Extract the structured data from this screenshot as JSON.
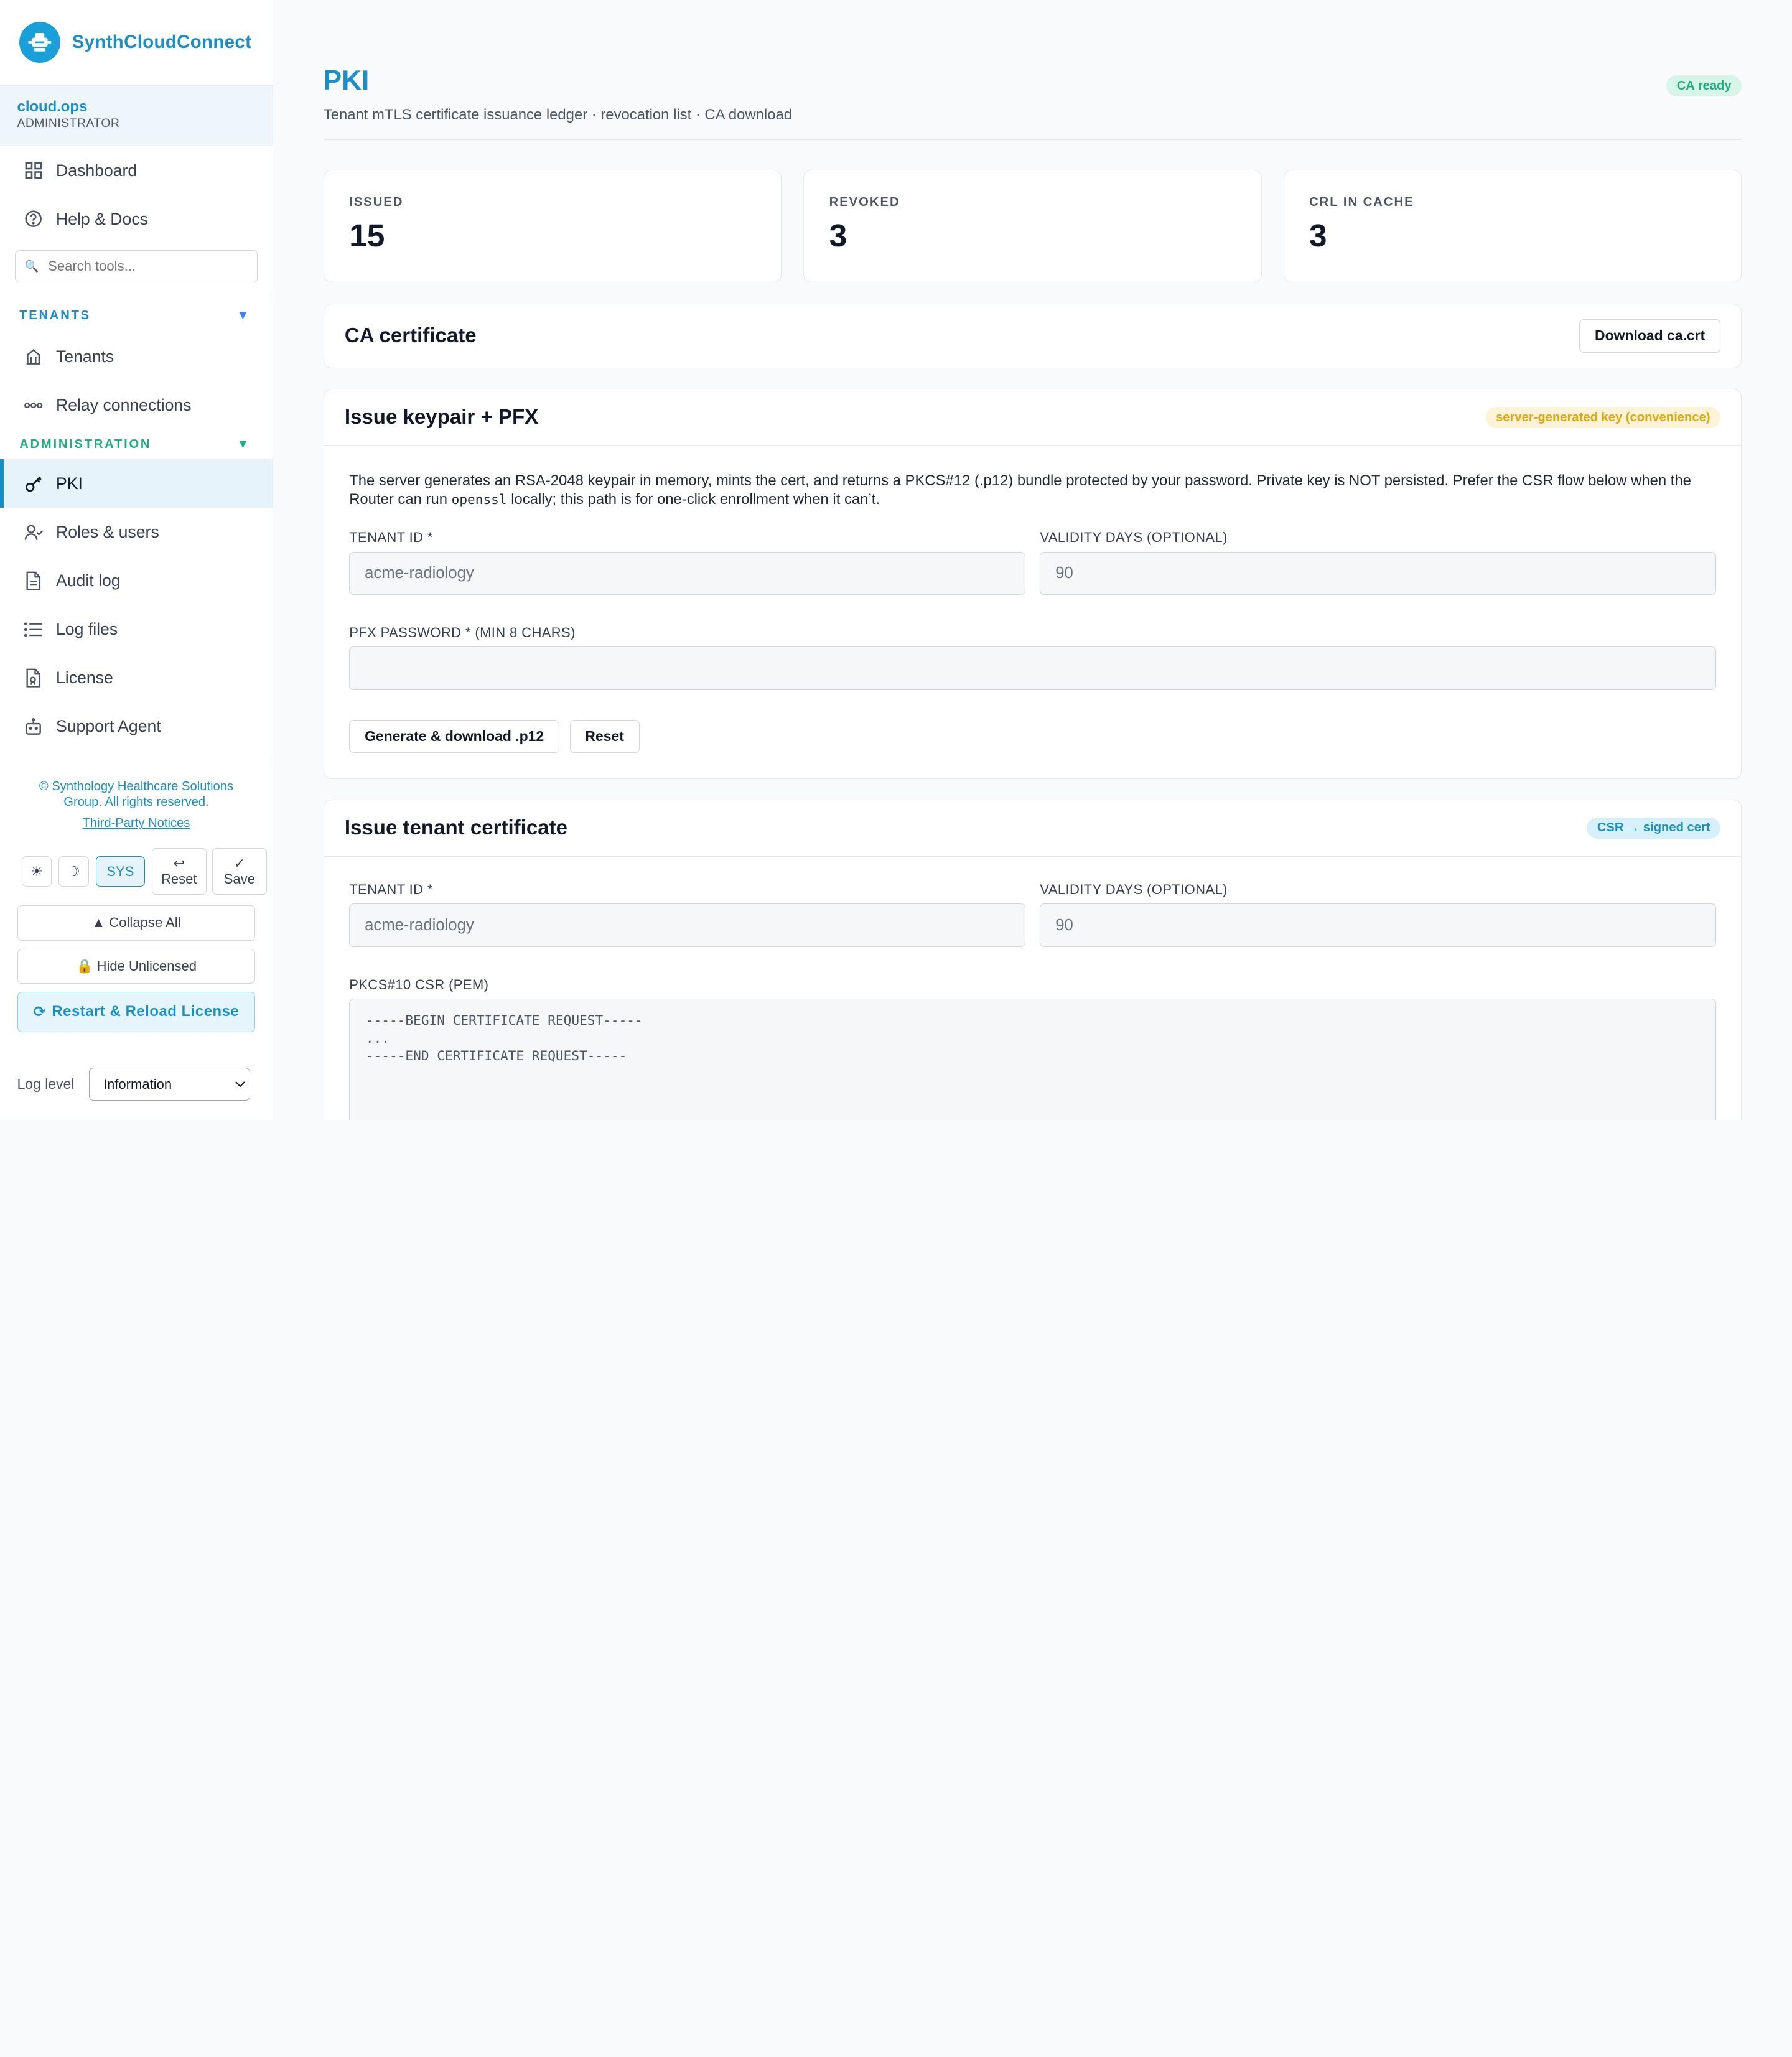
{
  "brand": {
    "name": "SynthCloudConnect"
  },
  "user": {
    "name": "cloud.ops",
    "role": "ADMINISTRATOR"
  },
  "nav_top": [
    {
      "label": "Dashboard",
      "icon": "grid-icon"
    },
    {
      "label": "Help & Docs",
      "icon": "help-circle-icon"
    }
  ],
  "search": {
    "placeholder": "Search tools..."
  },
  "sections": {
    "tenants": {
      "title": "TENANTS",
      "items": [
        {
          "label": "Tenants",
          "icon": "building-icon"
        },
        {
          "label": "Relay connections",
          "icon": "relay-icon"
        }
      ]
    },
    "admin": {
      "title": "ADMINISTRATION",
      "items": [
        {
          "label": "PKI",
          "icon": "key-icon",
          "active": true
        },
        {
          "label": "Roles & users",
          "icon": "user-check-icon"
        },
        {
          "label": "Audit log",
          "icon": "document-icon"
        },
        {
          "label": "Log files",
          "icon": "list-icon"
        },
        {
          "label": "License",
          "icon": "license-icon"
        },
        {
          "label": "Support Agent",
          "icon": "robot-icon"
        }
      ]
    }
  },
  "footer": {
    "copyright": "© Synthology Healthcare Solutions Group. All rights reserved.",
    "notices": "Third-Party Notices",
    "theme_light": "☀",
    "theme_dark": "☽",
    "theme_sys": "SYS",
    "reset_glyph": "↩",
    "reset_label": "Reset",
    "save_glyph": "✓",
    "save_label": "Save",
    "collapse_all": "▲ Collapse All",
    "hide_unlicensed": "🔒 Hide Unlicensed",
    "restart_reload": "Restart & Reload License",
    "log_level_label": "Log level",
    "log_level_value": "Information"
  },
  "page": {
    "title": "PKI",
    "subtitle": "Tenant mTLS certificate issuance ledger · revocation list · CA download",
    "status_badge": "CA ready"
  },
  "stats": [
    {
      "label": "ISSUED",
      "value": "15"
    },
    {
      "label": "REVOKED",
      "value": "3"
    },
    {
      "label": "CRL IN CACHE",
      "value": "3"
    }
  ],
  "ca_card": {
    "title": "CA certificate",
    "download_label": "Download ca.crt"
  },
  "pfx_card": {
    "title": "Issue keypair + PFX",
    "badge": "server-generated key (convenience)",
    "desc_part1": "The server generates an RSA-2048 keypair in memory, mints the cert, and returns a PKCS#12 (.p12) bundle protected by your password. Private key is NOT persisted. Prefer the CSR flow below when the Router can run ",
    "desc_code": "openssl",
    "desc_part2": " locally; this path is for one-click enrollment when it can’t.",
    "tenant_label": "TENANT ID *",
    "tenant_value": "acme-radiology",
    "validity_label": "VALIDITY DAYS (OPTIONAL)",
    "validity_value": "90",
    "password_label": "PFX PASSWORD * (MIN 8 CHARS)",
    "password_value": "",
    "generate_label": "Generate & download .p12",
    "reset_label": "Reset"
  },
  "csr_card": {
    "title": "Issue tenant certificate",
    "badge": "CSR → signed cert",
    "tenant_label": "TENANT ID *",
    "tenant_value": "acme-radiology",
    "validity_label": "VALIDITY DAYS (OPTIONAL)",
    "validity_value": "90",
    "csr_label": "PKCS#10 CSR (PEM)",
    "csr_value": "-----BEGIN CERTIFICATE REQUEST-----\n...\n-----END CERTIFICATE REQUEST-----"
  },
  "colors": {
    "accent": "#1a8fc7",
    "success": "#1fae7f",
    "warning": "#e0a80c"
  }
}
